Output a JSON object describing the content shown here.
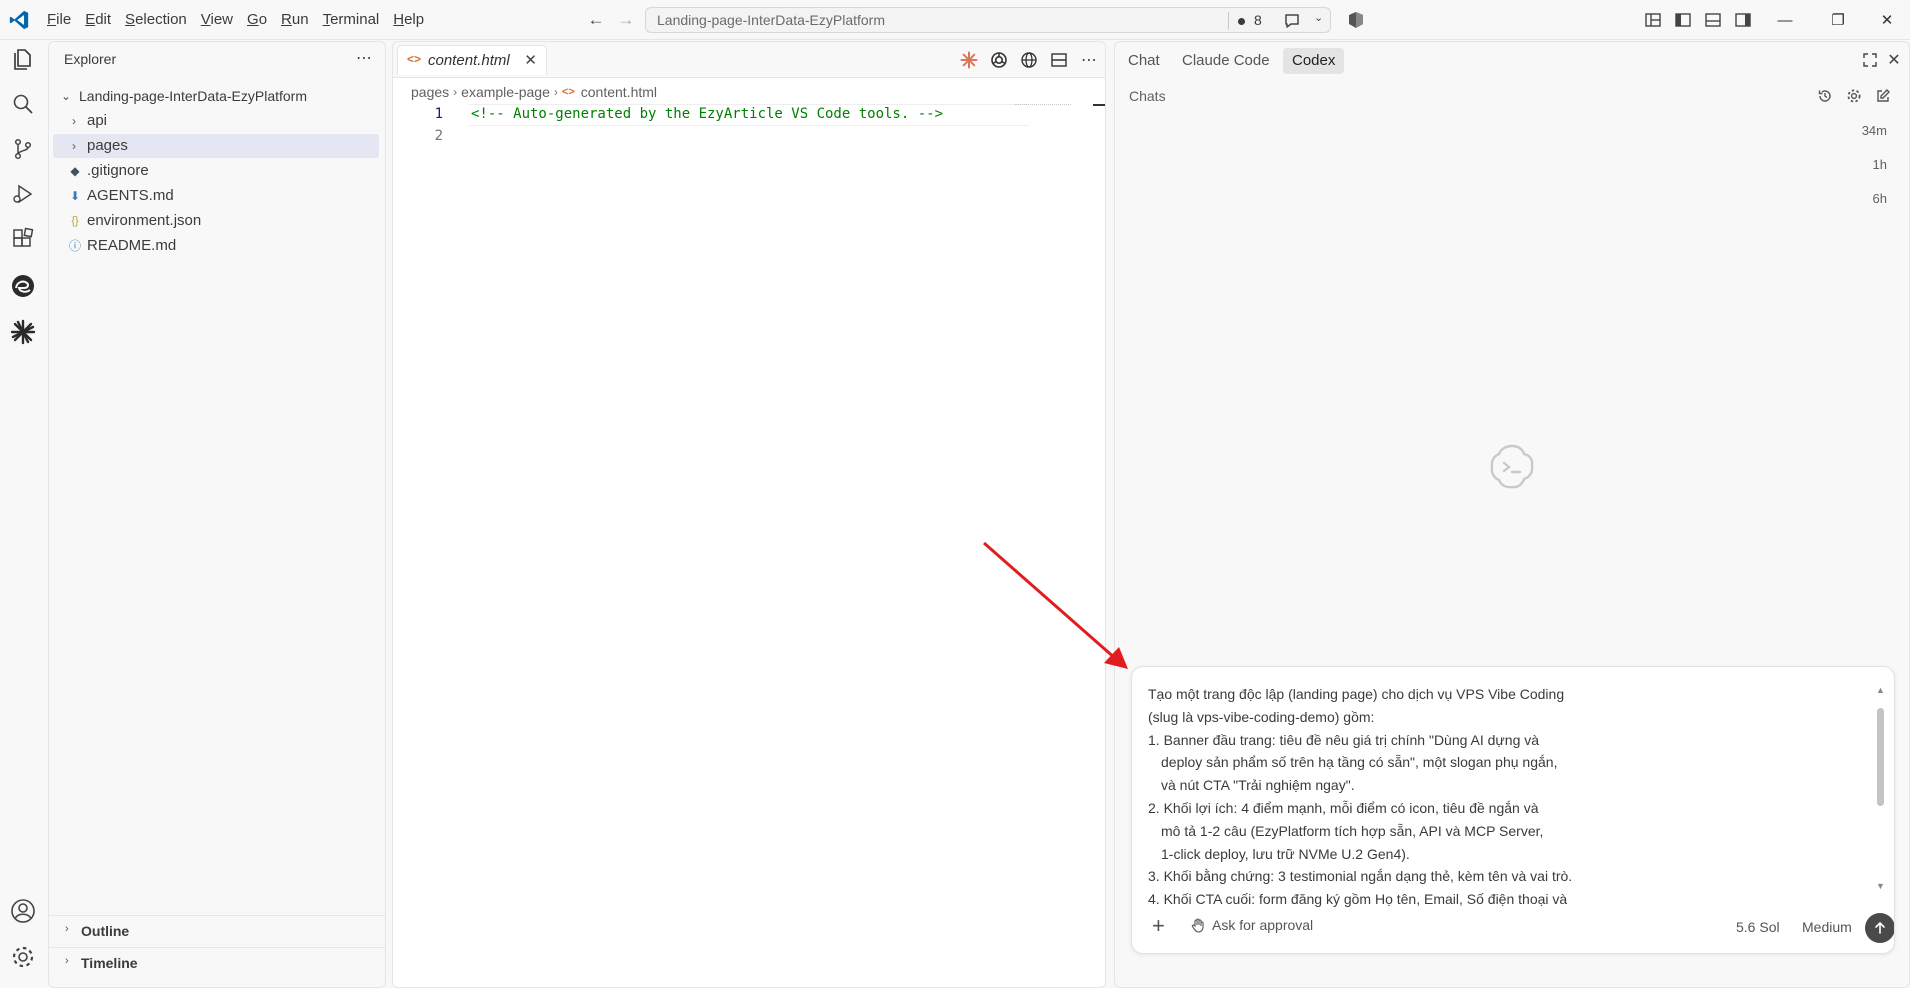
{
  "titlebar": {
    "menu": [
      {
        "pre": "",
        "u": "F",
        "post": "ile"
      },
      {
        "pre": "",
        "u": "E",
        "post": "dit"
      },
      {
        "pre": "",
        "u": "S",
        "post": "election"
      },
      {
        "pre": "",
        "u": "V",
        "post": "iew"
      },
      {
        "pre": "",
        "u": "G",
        "post": "o"
      },
      {
        "pre": "",
        "u": "R",
        "post": "un"
      },
      {
        "pre": "",
        "u": "T",
        "post": "erminal"
      },
      {
        "pre": "",
        "u": "H",
        "post": "elp"
      }
    ],
    "search_text": "Landing-page-InterData-EzyPlatform",
    "notification_count": "8"
  },
  "sidebar": {
    "title": "Explorer",
    "root": "Landing-page-InterData-EzyPlatform",
    "items": [
      {
        "label": "api",
        "kind": "folder",
        "icon": ""
      },
      {
        "label": "pages",
        "kind": "folder",
        "icon": ""
      },
      {
        "label": ".gitignore",
        "kind": "file",
        "icon": "git-diamond-icon"
      },
      {
        "label": "AGENTS.md",
        "kind": "file",
        "icon": "markdown-down-arrow-icon"
      },
      {
        "label": "environment.json",
        "kind": "file",
        "icon": "braces-icon"
      },
      {
        "label": "README.md",
        "kind": "file",
        "icon": "info-icon"
      }
    ],
    "outline_label": "Outline",
    "timeline_label": "Timeline"
  },
  "editor": {
    "tab_label": "content.html",
    "breadcrumb": [
      "pages",
      "example-page",
      "content.html"
    ],
    "lines": [
      {
        "num": "1",
        "text": "<!-- Auto-generated by the EzyArticle VS Code tools. -->"
      },
      {
        "num": "2",
        "text": ""
      }
    ]
  },
  "chat": {
    "tabs": [
      "Chat",
      "Claude Code",
      "Codex"
    ],
    "active_tab": "Codex",
    "chats_label": "Chats",
    "times": [
      "34m",
      "1h",
      "6h"
    ],
    "prompt_lines": [
      {
        "text": "Tạo một trang độc lập (landing page) cho dịch vụ VPS Vibe Coding",
        "indent": false
      },
      {
        "text": "(slug là vps-vibe-coding-demo) gồm:",
        "indent": false
      },
      {
        "text": "1. Banner đầu trang: tiêu đề nêu giá trị chính \"Dùng AI dựng và",
        "indent": false
      },
      {
        "text": "deploy sản phẩm số trên hạ tầng có sẵn\", một slogan phụ ngắn,",
        "indent": true
      },
      {
        "text": "và nút CTA \"Trải nghiệm ngay\".",
        "indent": true
      },
      {
        "text": "2. Khối lợi ích: 4 điểm mạnh, mỗi điểm có icon, tiêu đề ngắn và",
        "indent": false
      },
      {
        "text": "mô tả 1-2 câu (EzyPlatform tích hợp sẵn, API và MCP Server,",
        "indent": true
      },
      {
        "text": "1-click deploy, lưu trữ NVMe U.2 Gen4).",
        "indent": true
      },
      {
        "text": "3. Khối bằng chứng: 3 testimonial ngắn dạng thẻ, kèm tên và vai trò.",
        "indent": false
      },
      {
        "text": "4. Khối CTA cuối: form đăng ký gồm Họ tên, Email, Số điện thoại và",
        "indent": false
      }
    ],
    "approval_label": "Ask for approval",
    "model_label": "5.6 Sol",
    "effort_label": "Medium"
  },
  "colors": {
    "vscode_blue": "#0065a9",
    "html_icon": "#d4702e",
    "comment_green": "#008000",
    "annotation_arrow": "#e11d1d",
    "selection": "#e4e6f1"
  }
}
